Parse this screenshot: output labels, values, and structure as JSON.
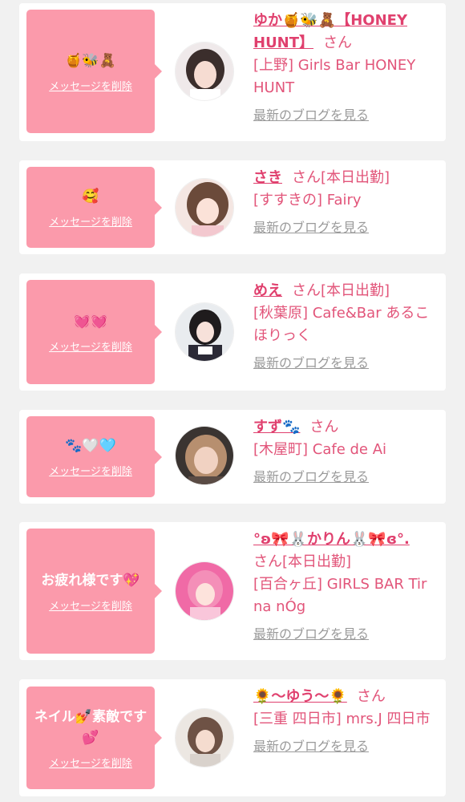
{
  "cards": [
    {
      "message": "🍯🐝🧸",
      "delete_label": "メッセージを削除",
      "name": "ゆか🍯🐝🧸【HONEY HUNT】",
      "suffix": "さん",
      "shop": "[上野] Girls Bar HONEY HUNT",
      "blog_label": "最新のブログを見る"
    },
    {
      "message": "🥰",
      "delete_label": "メッセージを削除",
      "name": "さき",
      "suffix": "さん[本日出勤]",
      "shop": "[すすきの] Fairy",
      "blog_label": "最新のブログを見る"
    },
    {
      "message": "💓💓",
      "delete_label": "メッセージを削除",
      "name": "めえ",
      "suffix": "さん[本日出勤]",
      "shop": "[秋葉原] Cafe&Bar あるこほりっく",
      "blog_label": "最新のブログを見る"
    },
    {
      "message": "🐾🤍🩵",
      "delete_label": "メッセージを削除",
      "name": "すず🐾",
      "suffix": "さん",
      "shop": "[木屋町] Cafe de Ai",
      "blog_label": "最新のブログを見る"
    },
    {
      "message": "お疲れ様です💖",
      "delete_label": "メッセージを削除",
      "name": "°ʚ🎀🐰かりん🐰🎀ɞ°.",
      "suffix": "さん[本日出勤]",
      "shop": "[百合ヶ丘] GIRLS BAR Tir na nÓg",
      "blog_label": "最新のブログを見る"
    },
    {
      "message": "ネイル💅素敵です💕",
      "delete_label": "メッセージを削除",
      "name": "🌻〜ゆう〜🌻",
      "suffix": "さん",
      "shop": "[三重 四日市] mrs.J 四日市",
      "blog_label": "最新のブログを見る"
    }
  ],
  "colors": {
    "bubble": "#fb9aab",
    "name": "#e0406e",
    "text": "#e2557a",
    "link": "#9a9a9a"
  }
}
